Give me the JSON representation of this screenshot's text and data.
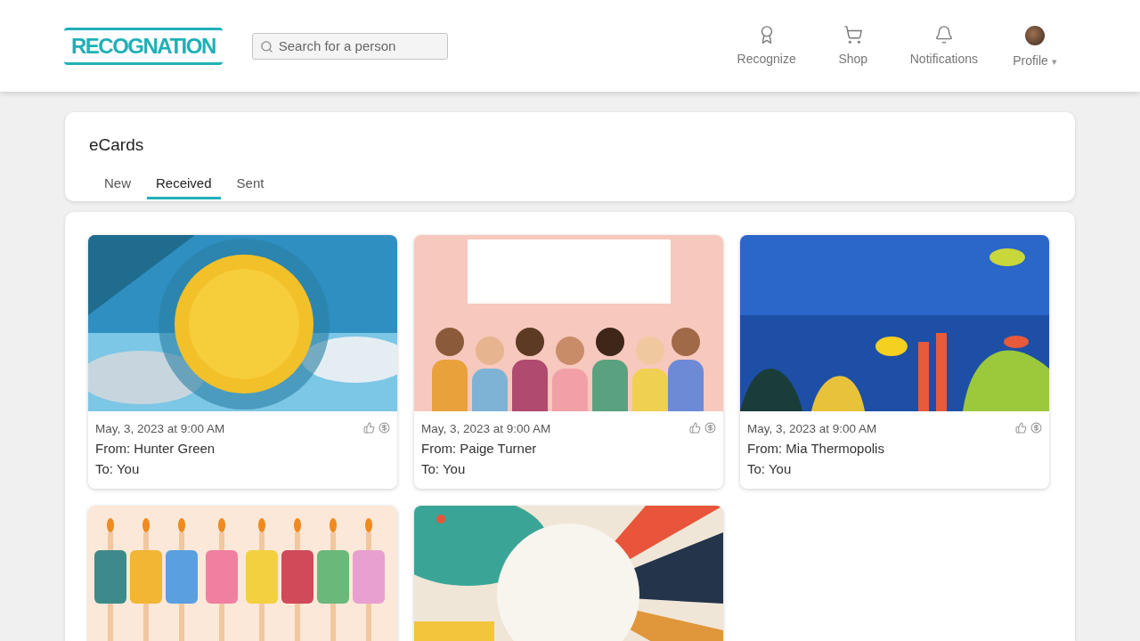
{
  "header": {
    "logo": "RECOGNATION",
    "search": {
      "placeholder": "Search for a person"
    },
    "nav": [
      {
        "kind": "award",
        "label": "Recognize"
      },
      {
        "kind": "cart",
        "label": "Shop"
      },
      {
        "kind": "bell",
        "label": "Notifications"
      },
      {
        "kind": "avatar",
        "label": "Profile",
        "caret": "▾"
      }
    ]
  },
  "ecards": {
    "title": "eCards",
    "tabs": [
      {
        "label": "New",
        "selected": false
      },
      {
        "label": "Received",
        "selected": true
      },
      {
        "label": "Sent",
        "selected": false
      }
    ],
    "cards": [
      {
        "kind": "picture",
        "date": "May, 3, 2023 at 9:00 AM",
        "from": "From: Hunter Green",
        "to": "To: You"
      },
      {
        "kind": "picture",
        "date": "May, 3, 2023 at 9:00 AM",
        "from": "From: Paige Turner",
        "to": "To: You"
      },
      {
        "kind": "picture",
        "date": "May, 3, 2023 at 9:00 AM",
        "from": "From: Mia Thermopolis",
        "to": "To: You"
      },
      {
        "kind": "picture"
      },
      {
        "kind": "picture"
      }
    ]
  }
}
